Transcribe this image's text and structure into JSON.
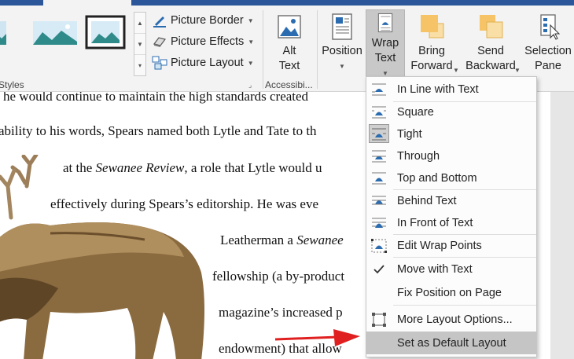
{
  "ribbon": {
    "picture_styles": {
      "group_label": "Styles",
      "commands": [
        {
          "label": "Picture Border",
          "icon": "picture-border-icon"
        },
        {
          "label": "Picture Effects",
          "icon": "picture-effects-icon"
        },
        {
          "label": "Picture Layout",
          "icon": "picture-layout-icon"
        }
      ]
    },
    "accessibility": {
      "group_label": "Accessibi...",
      "alt_text_line1": "Alt",
      "alt_text_line2": "Text"
    },
    "arrange": {
      "position_label": "Position",
      "wrap_text_line1": "Wrap",
      "wrap_text_line2": "Text",
      "bring_forward_line1": "Bring",
      "bring_forward_line2": "Forward",
      "send_backward_line1": "Send",
      "send_backward_line2": "Backward",
      "selection_pane_line1": "Selection",
      "selection_pane_line2": "Pane"
    }
  },
  "document": {
    "lines": [
      {
        "pre": "he would continue to maintain the high standards created",
        "it": "",
        "post": ""
      },
      {
        "pre": "ability to his words, Spears named both Lytle and Tate to th",
        "it": "",
        "post": ""
      },
      {
        "pre": "at the ",
        "it": "Sewanee Review",
        "post": ", a role that Lytle would u"
      },
      {
        "pre": "effectively during Spears’s editorship.  He was eve",
        "it": "",
        "post": ""
      },
      {
        "pre": "Leatherman a ",
        "it": "Sewanee",
        "post": ""
      },
      {
        "pre": "fellowship (a by-product",
        "it": "",
        "post": ""
      },
      {
        "pre": "magazine’s increased p",
        "it": "",
        "post": ""
      },
      {
        "pre": "endowment) that allow",
        "it": "",
        "post": ""
      }
    ]
  },
  "wrap_menu": {
    "items": [
      {
        "label": "In Line with Text",
        "icon": "inline-with-text-icon"
      },
      {
        "label": "Square",
        "icon": "square-wrap-icon"
      },
      {
        "label": "Tight",
        "icon": "tight-wrap-icon",
        "selected": true
      },
      {
        "label": "Through",
        "icon": "through-wrap-icon"
      },
      {
        "label": "Top and Bottom",
        "icon": "top-and-bottom-icon"
      },
      {
        "label": "Behind Text",
        "icon": "behind-text-icon"
      },
      {
        "label": "In Front of Text",
        "icon": "in-front-of-text-icon"
      },
      {
        "label": "Edit Wrap Points",
        "icon": "edit-wrap-points-icon"
      },
      {
        "label": "Move with Text",
        "icon": "checkmark-icon",
        "checked": true
      },
      {
        "label": "Fix Position on Page",
        "icon": ""
      },
      {
        "label": "More Layout Options...",
        "icon": "layout-options-icon"
      },
      {
        "label": "Set as Default Layout",
        "icon": "",
        "hovered": true
      }
    ]
  },
  "colors": {
    "title_bar": "#2b579a",
    "ribbon_bg": "#f3f3f3",
    "menu_hover": "#c5c5c5",
    "arrow_red": "#e02020",
    "icon_blue": "#2b6cb0",
    "bring_forward_fill": "#f6c466"
  }
}
